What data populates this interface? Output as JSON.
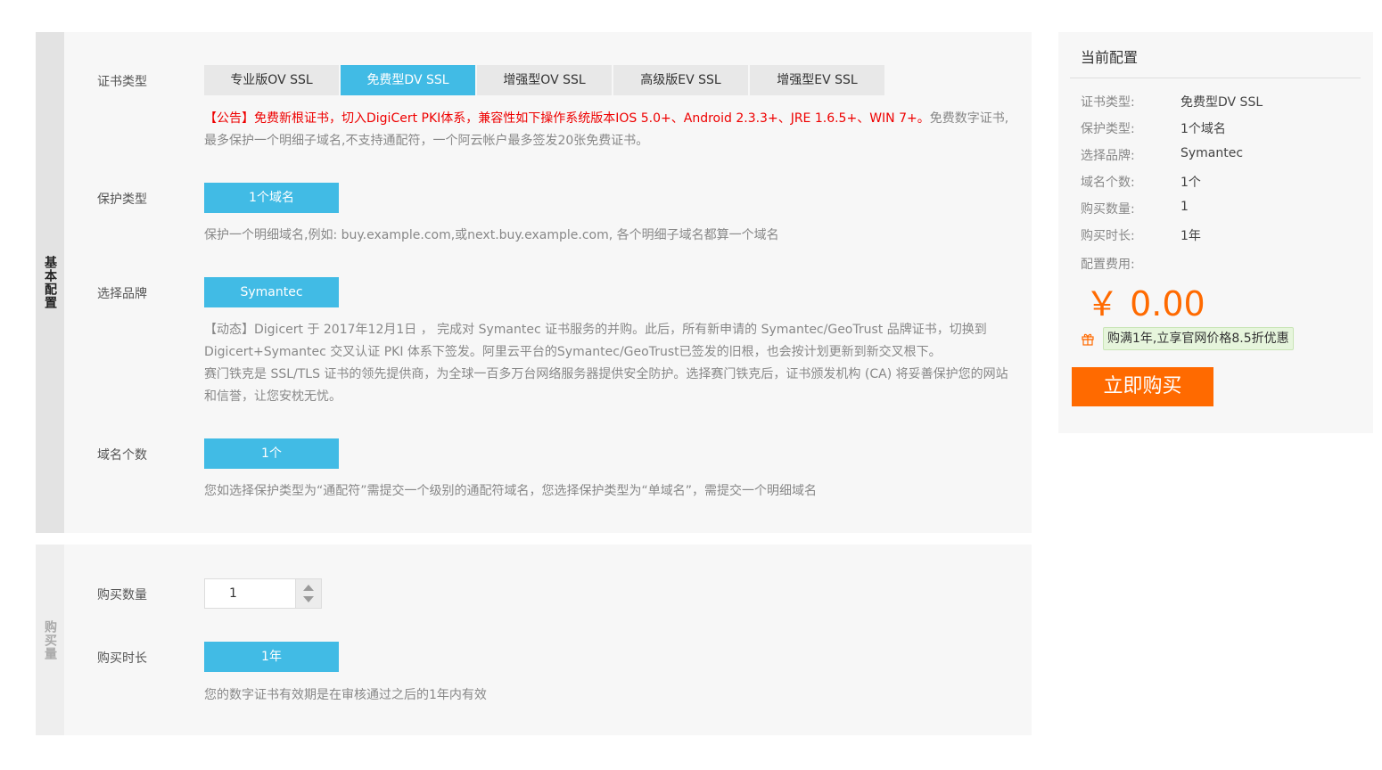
{
  "basic": {
    "side_label": "基本配置",
    "cert_type": {
      "label": "证书类型",
      "tabs": [
        "专业版OV SSL",
        "免费型DV SSL",
        "增强型OV SSL",
        "高级版EV SSL",
        "增强型EV SSL"
      ],
      "active": "免费型DV SSL",
      "notice_red": "【公告】免费新根证书，切入DigiCert PKI体系，兼容性如下操作系统版本IOS 5.0+、Android 2.3.3+、JRE 1.6.5+、WIN 7+。",
      "notice_gray": "免费数字证书,最多保护一个明细子域名,不支持通配符，一个阿云帐户最多签发20张免费证书。"
    },
    "protect_type": {
      "label": "保护类型",
      "button": "1个域名",
      "desc": "保护一个明细域名,例如: buy.example.com,或next.buy.example.com, 各个明细子域名都算一个域名"
    },
    "brand": {
      "label": "选择品牌",
      "button": "Symantec",
      "desc1": "【动态】Digicert 于 2017年12月1日 ， 完成对 Symantec 证书服务的并购。此后，所有新申请的 Symantec/GeoTrust 品牌证书，切换到 Digicert+Symantec 交叉认证 PKI 体系下签发。阿里云平台的Symantec/GeoTrust已签发的旧根，也会按计划更新到新交叉根下。",
      "desc2": "赛门铁克是 SSL/TLS 证书的领先提供商，为全球一百多万台网络服务器提供安全防护。选择赛门铁克后，证书颁发机构 (CA) 将妥善保护您的网站和信誉，让您安枕无忧。"
    },
    "domain_count": {
      "label": "域名个数",
      "button": "1个",
      "desc": "您如选择保护类型为“通配符”需提交一个级别的通配符域名，您选择保护类型为“单域名”，需提交一个明细域名"
    }
  },
  "purchase": {
    "side_label": "购买量",
    "quantity": {
      "label": "购买数量",
      "value": "1"
    },
    "duration": {
      "label": "购买时长",
      "button": "1年",
      "desc": "您的数字证书有效期是在审核通过之后的1年内有效"
    }
  },
  "summary": {
    "title": "当前配置",
    "rows": [
      {
        "key": "证书类型:",
        "value": "免费型DV SSL"
      },
      {
        "key": "保护类型:",
        "value": "1个域名"
      },
      {
        "key": "选择品牌:",
        "value": "Symantec"
      },
      {
        "key": "域名个数:",
        "value": "1个"
      },
      {
        "key": "购买数量:",
        "value": "1"
      },
      {
        "key": "购买时长:",
        "value": "1年"
      }
    ],
    "fee_label": "配置费用:",
    "price": "￥ 0.00",
    "promo": "购满1年,立享官网价格8.5折优惠",
    "buy_button": "立即购买",
    "gift_icon": "gift-icon",
    "colors": {
      "accent": "#41bbe5",
      "price": "#ff6a00",
      "buy": "#ff6a00",
      "notice": "#ee0000"
    }
  }
}
